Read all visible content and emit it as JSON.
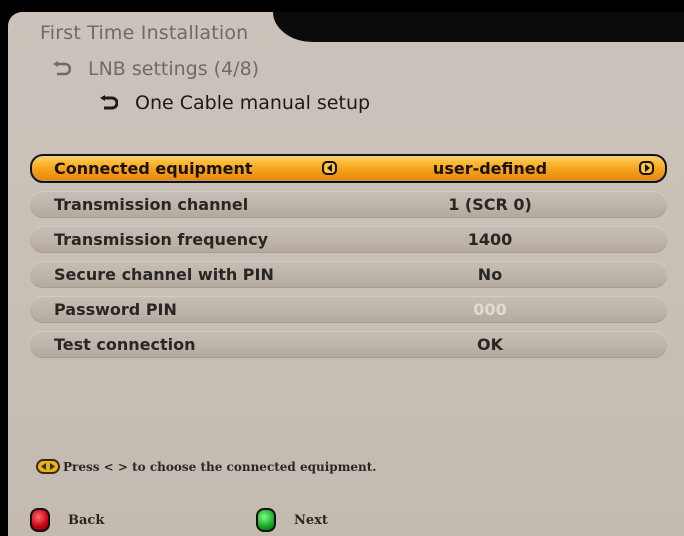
{
  "header": {
    "title": "First Time Installation",
    "breadcrumb_1": "LNB settings (4/8)",
    "breadcrumb_2": "One Cable manual setup"
  },
  "menu": {
    "rows": [
      {
        "label": "Connected equipment",
        "value": "user-defined",
        "selected": true
      },
      {
        "label": "Transmission channel",
        "value": "1 (SCR 0)"
      },
      {
        "label": "Transmission frequency",
        "value": "1400"
      },
      {
        "label": "Secure channel with PIN",
        "value": "No"
      },
      {
        "label": "Password PIN",
        "value": "000",
        "disabled": true
      },
      {
        "label": "Test connection",
        "value": "OK"
      }
    ]
  },
  "hint": {
    "text": "Press < > to choose the connected equipment.",
    "icon": "left-right-keys-icon"
  },
  "footer": {
    "back_label": "Back",
    "next_label": "Next",
    "back_color": "#d0101a",
    "next_color": "#1fa82e"
  },
  "colors": {
    "selected_row": "#f7a51d",
    "panel": "#c9c1b8"
  }
}
